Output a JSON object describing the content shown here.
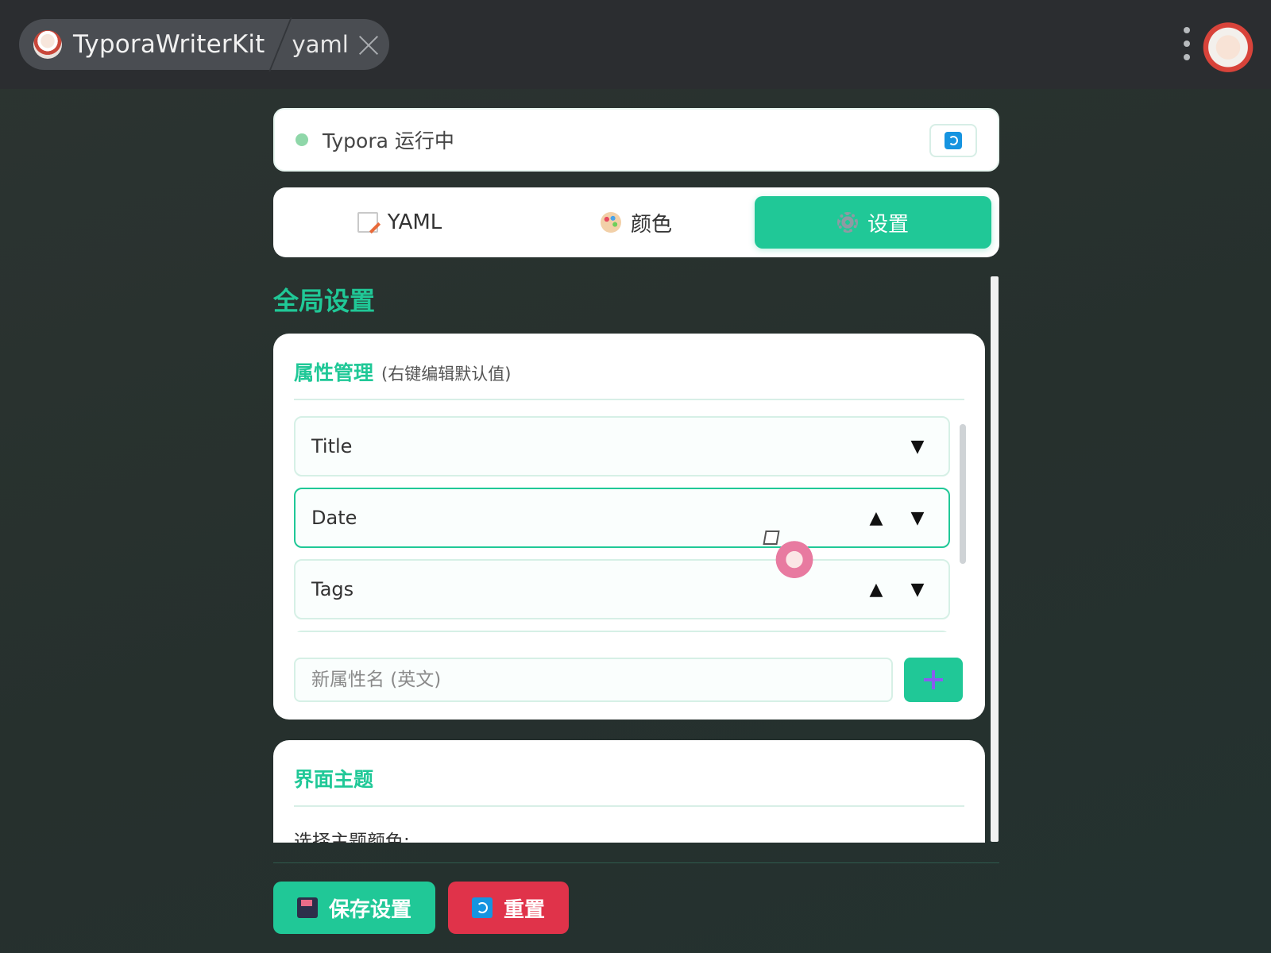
{
  "window": {
    "app_name": "TyporaWriterKit",
    "tab_name": "yaml"
  },
  "status": {
    "text": "Typora 运行中",
    "indicator_color": "#8fd7a9"
  },
  "tabs": [
    {
      "label": "YAML",
      "icon": "memo-icon"
    },
    {
      "label": "颜色",
      "icon": "palette-icon"
    },
    {
      "label": "设置",
      "icon": "gear-icon",
      "active": true
    }
  ],
  "main": {
    "section_title": "全局设置",
    "attributes": {
      "title": "属性管理",
      "subtitle": "(右键编辑默认值)",
      "items": [
        {
          "label": "Title"
        },
        {
          "label": "Date",
          "selected": true
        },
        {
          "label": "Tags"
        }
      ],
      "new_attr_placeholder": "新属性名 (英文)"
    },
    "theme": {
      "title": "界面主题",
      "label": "选择主题颜色:"
    }
  },
  "footer": {
    "save_label": "保存设置",
    "reset_label": "重置"
  },
  "colors": {
    "accent": "#20c897",
    "danger": "#e0334a",
    "info": "#1694e0"
  }
}
